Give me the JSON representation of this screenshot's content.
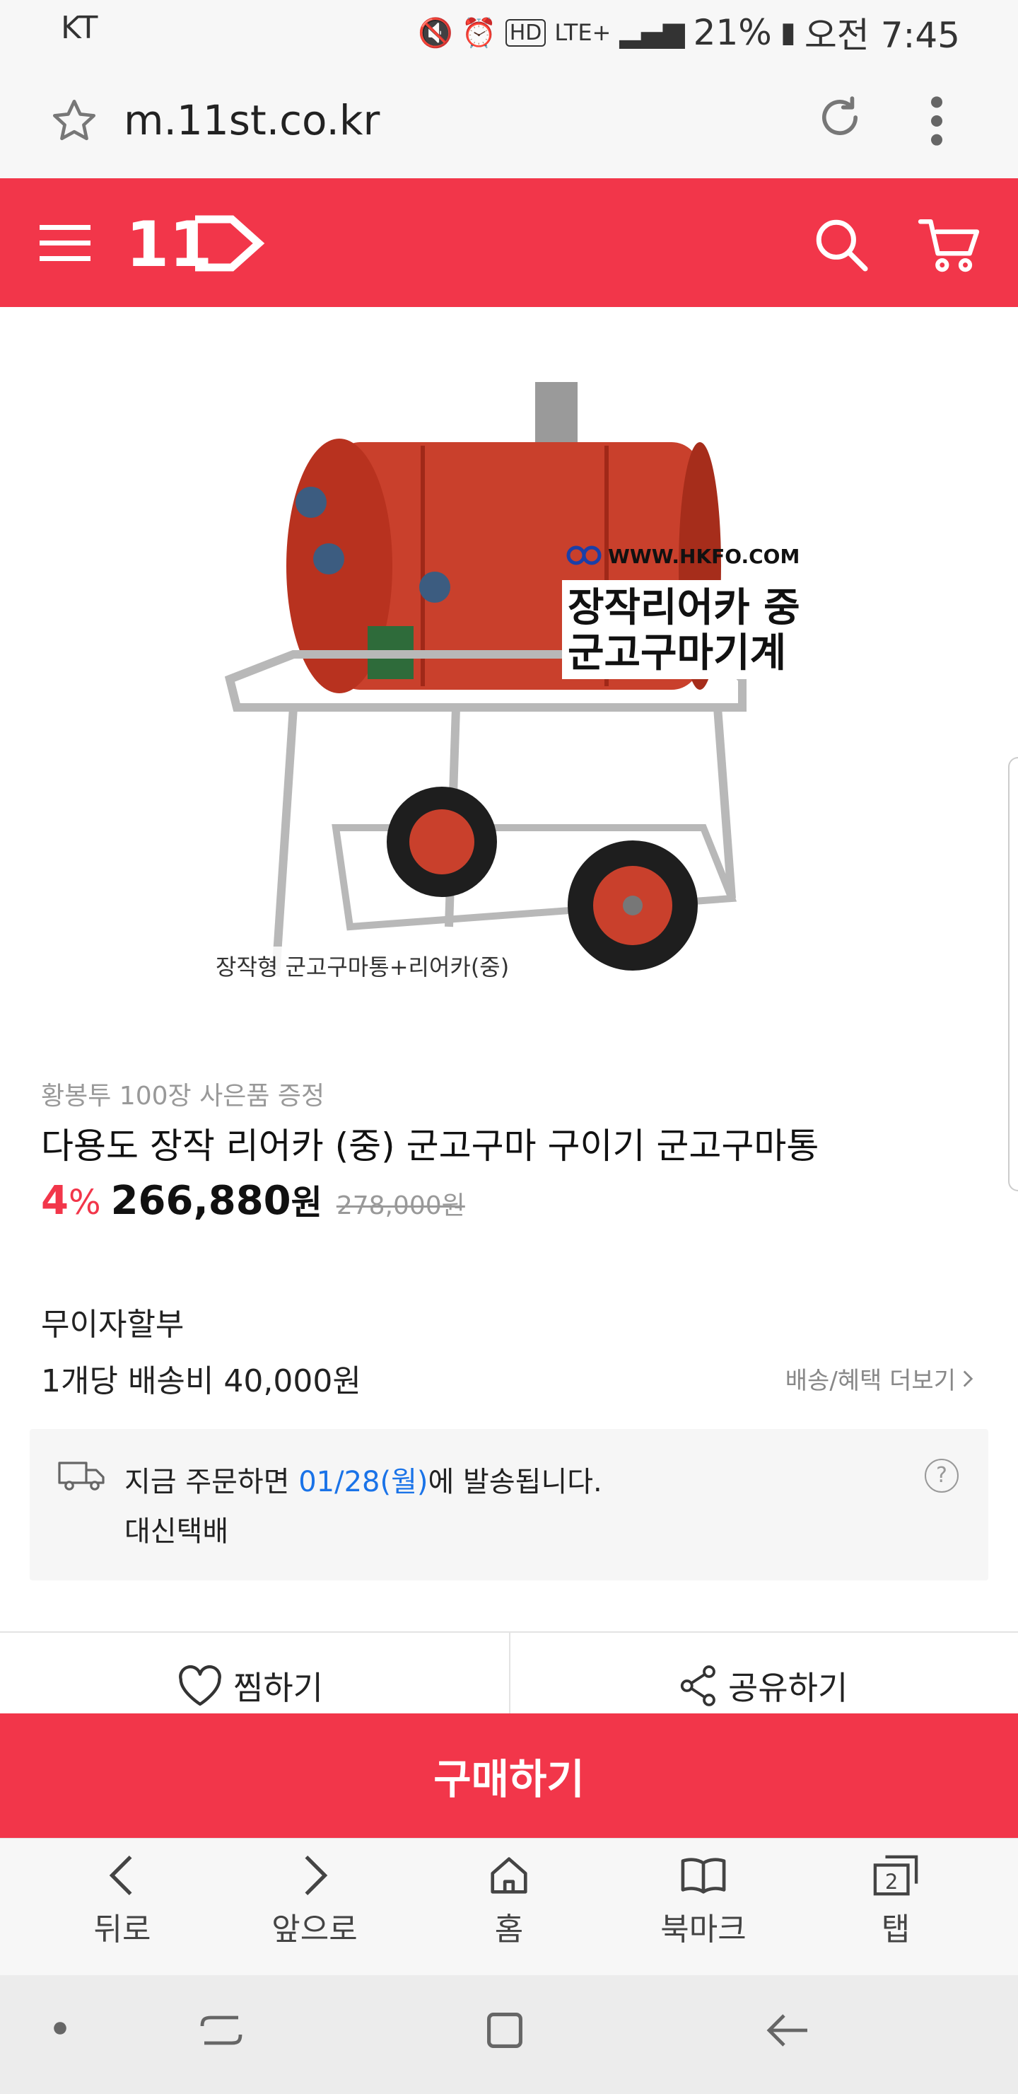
{
  "status_bar": {
    "carrier": "KT",
    "network": "LTE+",
    "battery": "21%",
    "time": "오전 7:45"
  },
  "browser": {
    "url": "m.11st.co.kr"
  },
  "header": {
    "logo_text": "11"
  },
  "product": {
    "image_overlay": {
      "site": "WWW.HKFO.COM",
      "headline_1": "장작리어카 중",
      "headline_2": "군고구마기계",
      "caption": "장작형 군고구마통+리어카(중)"
    },
    "promo": "황봉투 100장 사은품 증정",
    "title": "다용도 장작 리어카 (중) 군고구마 구이기 군고구마통",
    "discount_number": "4",
    "discount_unit": "%",
    "price_number": "266,880",
    "price_unit": "원",
    "original_price": "278,000원",
    "installment": "무이자할부",
    "shipping": "1개당 배송비 40,000원",
    "shipping_more": "배송/혜택 더보기"
  },
  "delivery": {
    "prefix": "지금 주문하면 ",
    "date": "01/28(월)",
    "suffix": "에 발송됩니다.",
    "courier": "대신택배",
    "help": "?"
  },
  "actions": {
    "wish": "찜하기",
    "share": "공유하기",
    "buy": "구매하기"
  },
  "bottom_nav": {
    "back": "뒤로",
    "forward": "앞으로",
    "home": "홈",
    "bookmark": "북마크",
    "tabs": "탭",
    "tab_count": "2"
  },
  "colors": {
    "brand": "#f2364a",
    "link_blue": "#1a73e8"
  }
}
